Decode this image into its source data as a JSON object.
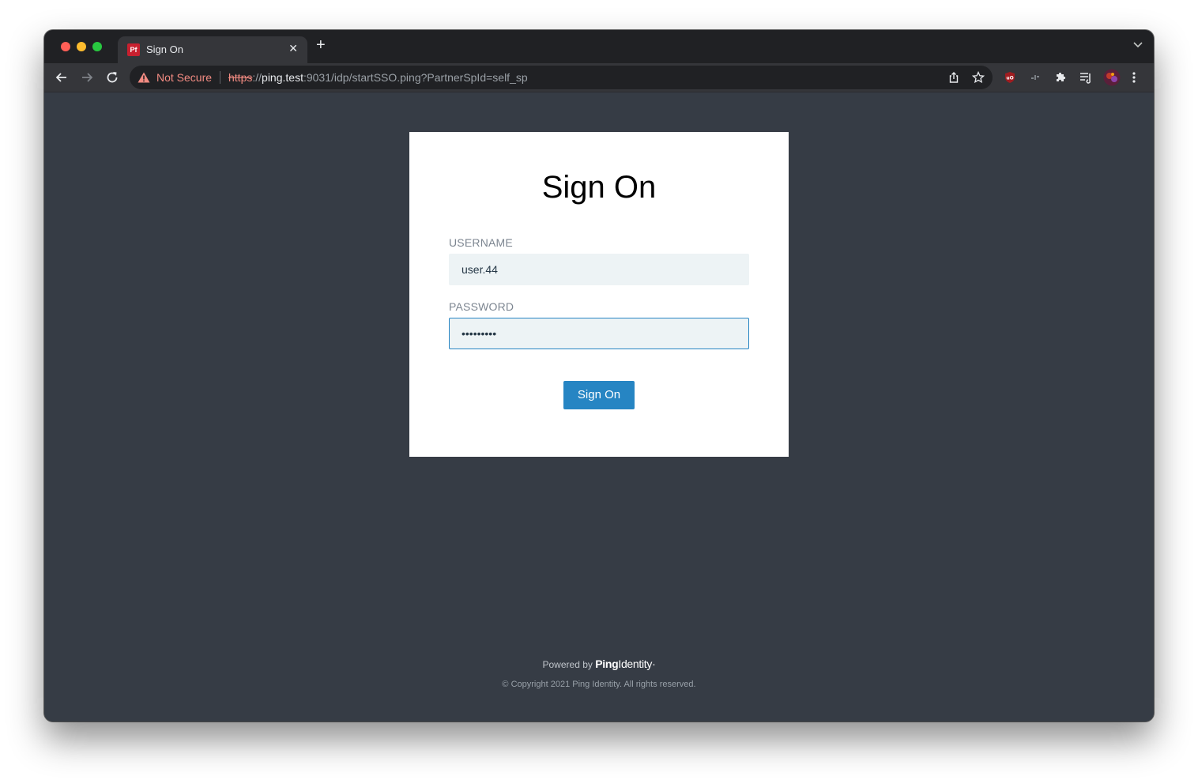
{
  "browser": {
    "tab": {
      "title": "Sign On",
      "favicon_text": "Pf"
    },
    "address_bar": {
      "security_label": "Not Secure",
      "url_scheme": "https",
      "url_separator": "://",
      "url_host": "ping.test",
      "url_rest": ":9031/idp/startSSO.ping?PartnerSpId=self_sp"
    },
    "extensions": [
      "ublock-icon",
      "extension-icon",
      "puzzle-icon",
      "reading-list-icon",
      "profile-avatar"
    ]
  },
  "login": {
    "title": "Sign On",
    "username_label": "USERNAME",
    "username_value": "user.44",
    "password_label": "PASSWORD",
    "password_value": "•••••••••",
    "submit_label": "Sign On"
  },
  "footer": {
    "powered_by": "Powered by",
    "brand_bold": "Ping",
    "brand_light": "Identity",
    "brand_mark": "·",
    "copyright": "© Copyright 2021 Ping Identity. All rights reserved."
  },
  "colors": {
    "page_background": "#363c45",
    "button": "#2685c3",
    "field_background": "#edf3f5",
    "warning": "#f28b82"
  }
}
